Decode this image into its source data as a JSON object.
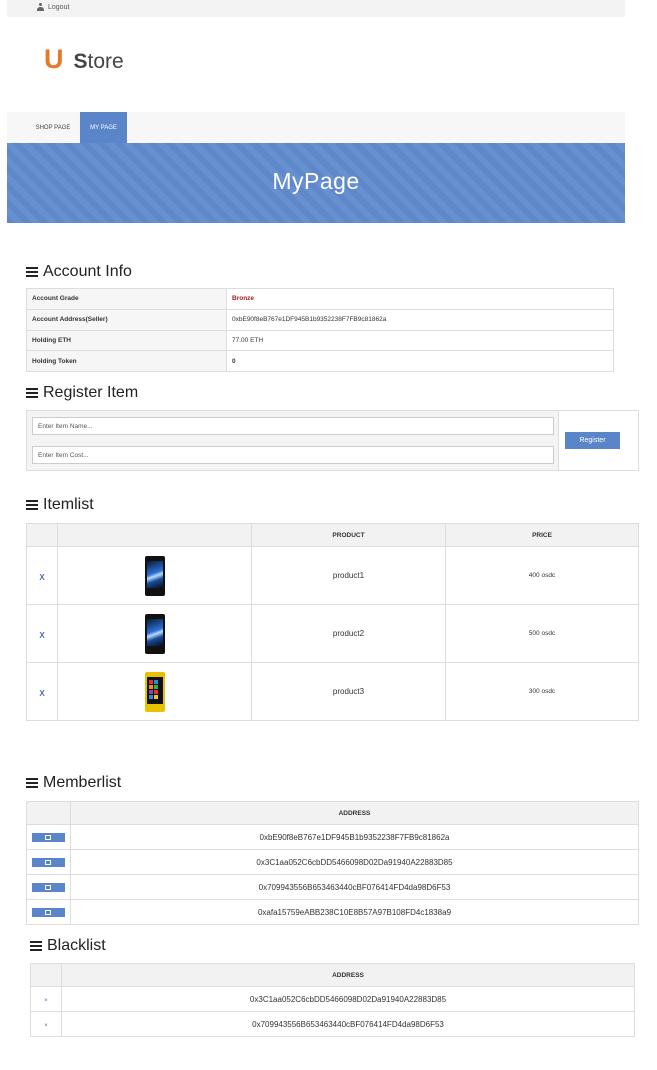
{
  "topbar": {
    "logout_label": "Logout",
    "logout_icon": "user-icon"
  },
  "logo": {
    "letter": "U",
    "store_first": "S",
    "store_rest": "tore",
    "accent_color": "#e8782d"
  },
  "nav": {
    "shop_label": "SHOP PAGE",
    "my_label": "MY PAGE",
    "active": "MY PAGE"
  },
  "banner": {
    "title": "MyPage"
  },
  "account": {
    "title": "Account Info",
    "rows": [
      {
        "label": "Account Grade",
        "value": "Bronze"
      },
      {
        "label": "Account Address(Seller)",
        "value": "0xbE90f8eB767e1DF945B1b9352238F7FB9c81862a"
      },
      {
        "label": "Holding ETH",
        "value": "77.00 ETH"
      },
      {
        "label": "Holding Token",
        "value": "0"
      }
    ]
  },
  "register": {
    "title": "Register Item",
    "name_placeholder": "Enter Item Name...",
    "cost_placeholder": "Enter Item Cost...",
    "button_label": "Register"
  },
  "itemlist": {
    "title": "Itemlist",
    "headers": {
      "product": "PRODUCT",
      "price": "PRICE"
    },
    "rows": [
      {
        "remove": "X",
        "product": "product1",
        "price": "400 osdc",
        "image": "xperia-phone"
      },
      {
        "remove": "X",
        "product": "product2",
        "price": "500 osdc",
        "image": "xperia-phone"
      },
      {
        "remove": "X",
        "product": "product3",
        "price": "300 osdc",
        "image": "lumia-phone"
      }
    ]
  },
  "memberlist": {
    "title": "Memberlist",
    "header": "ADDRESS",
    "rows": [
      "0xbE90f8eB767e1DF945B1b9352238F7FB9c81862a",
      "0x3C1aa052C6cbDD5466098D02Da91940A22883D85",
      "0x709943556B653463440cBF076414FD4da98D6F53",
      "0xafa15759eABB238C10E8B57A97B108FD4c1838a9"
    ]
  },
  "blacklist": {
    "title": "Blacklist",
    "header": "ADDRESS",
    "remove_mark": "×",
    "rows": [
      "0x3C1aa052C6cbDD5466098D02Da91940A22883D85",
      "0x709943556B653463440cBF076414FD4da98D6F53"
    ]
  },
  "colors": {
    "primary": "#5b85c9",
    "grade": "#a0201f"
  }
}
